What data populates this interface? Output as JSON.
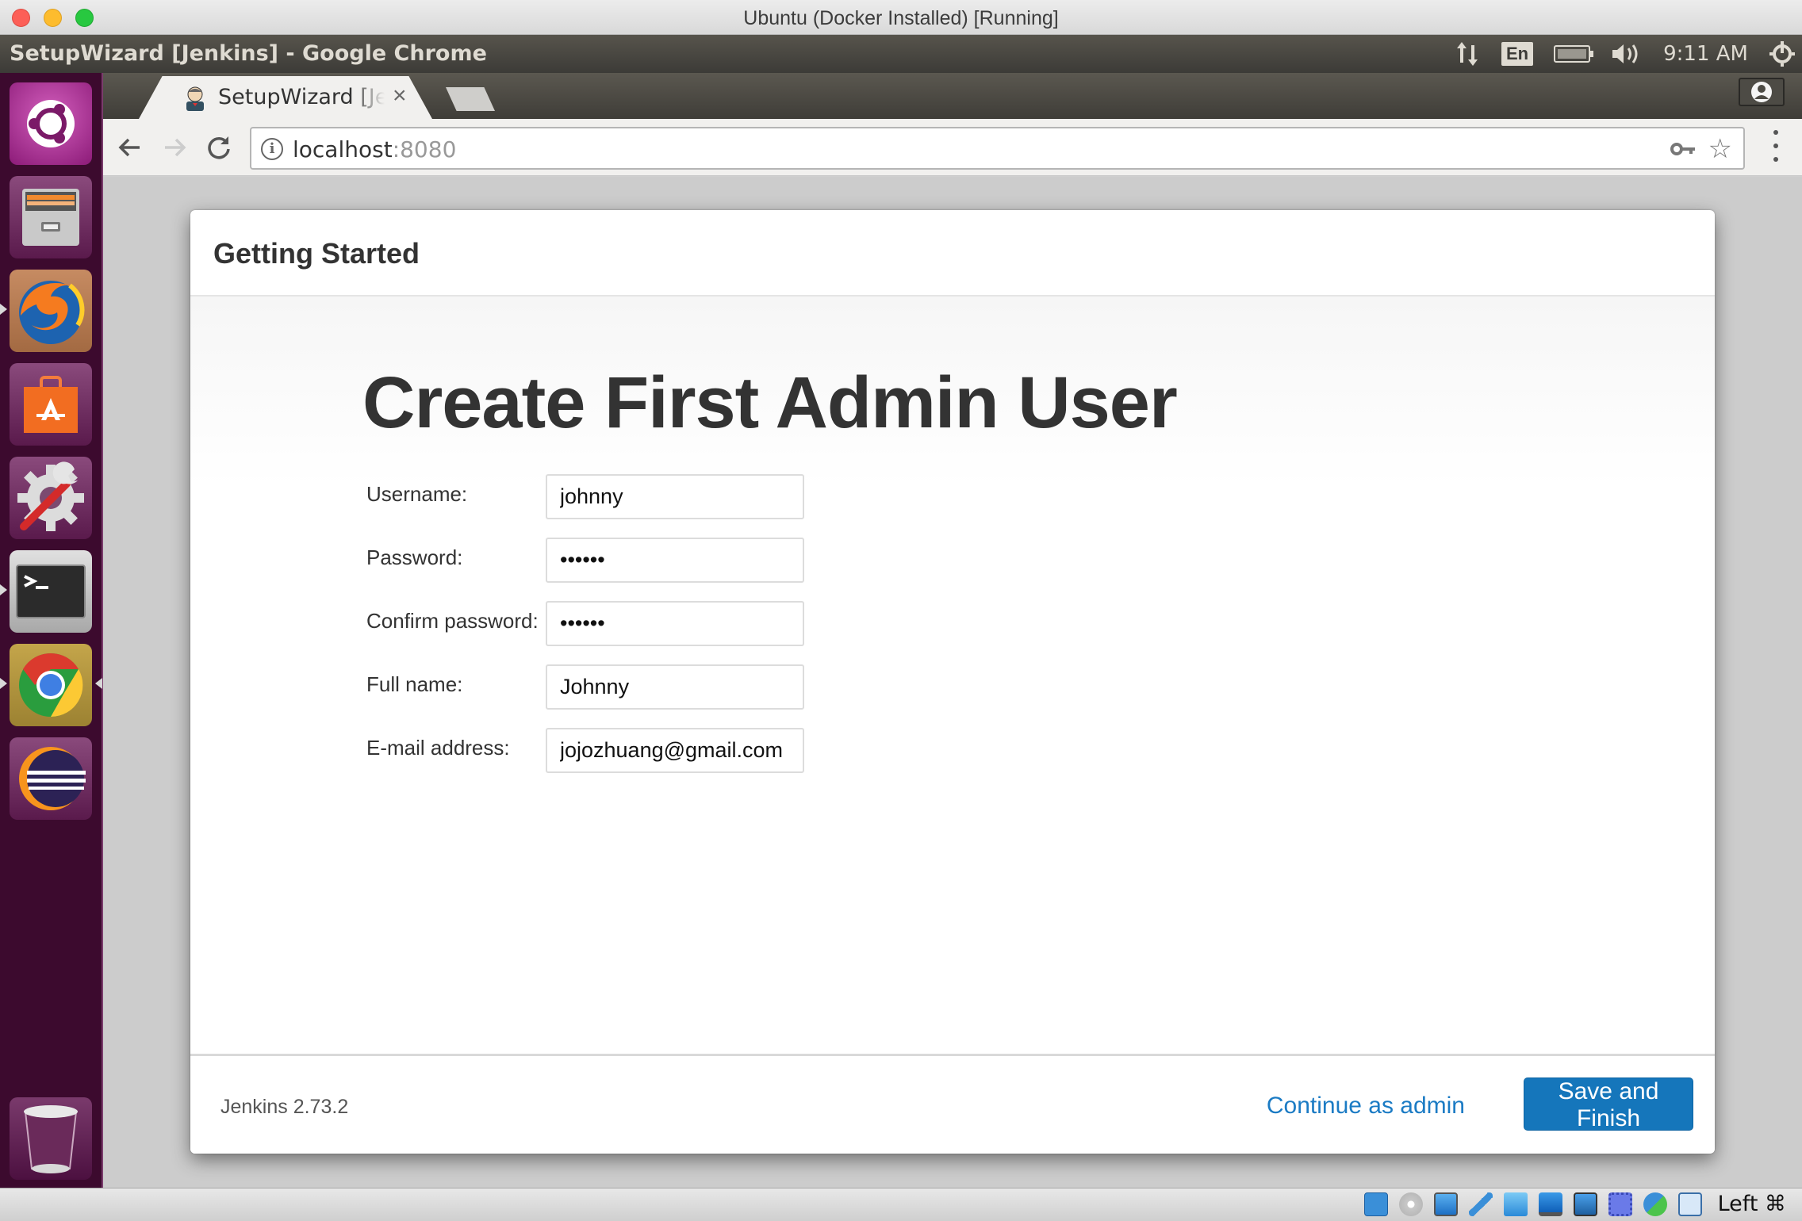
{
  "mac_window": {
    "title": "Ubuntu (Docker Installed) [Running]"
  },
  "ubuntu_panel": {
    "window_title": "SetupWizard [Jenkins] - Google Chrome",
    "indicators": {
      "network_icon": "network-updown-icon",
      "keyboard_layout": "En",
      "battery_icon": "battery-charging-icon",
      "volume_icon": "volume-icon",
      "clock": "9:11 AM",
      "power_icon": "power-gear-icon"
    }
  },
  "launcher": {
    "items": [
      {
        "name": "ubuntu-dash",
        "icon": "ubuntu-logo-icon"
      },
      {
        "name": "files",
        "icon": "file-cabinet-icon"
      },
      {
        "name": "firefox",
        "icon": "firefox-icon",
        "running": true
      },
      {
        "name": "software-center",
        "icon": "shopping-bag-icon"
      },
      {
        "name": "system-settings",
        "icon": "gear-wrench-icon"
      },
      {
        "name": "terminal",
        "icon": "terminal-icon",
        "running": true
      },
      {
        "name": "chrome",
        "icon": "chrome-icon",
        "running": true,
        "focused": true
      },
      {
        "name": "eclipse",
        "icon": "eclipse-icon"
      }
    ],
    "trash": {
      "name": "trash",
      "icon": "trash-icon"
    }
  },
  "browser": {
    "tab": {
      "title": "SetupWizard [Jenkins]",
      "close_glyph": "×"
    },
    "toolbar": {
      "back_glyph": "←",
      "forward_glyph": "→",
      "reload_glyph": "↻",
      "info_glyph": "i",
      "url_host": "localhost",
      "url_port": ":8080",
      "key_glyph": "⚷",
      "star_glyph": "☆"
    }
  },
  "wizard": {
    "header_title": "Getting Started",
    "heading": "Create First Admin User",
    "fields": [
      {
        "label": "Username:",
        "type": "text",
        "value": "johnny"
      },
      {
        "label": "Password:",
        "type": "password",
        "value": "••••••"
      },
      {
        "label": "Confirm password:",
        "type": "password",
        "value": "••••••"
      },
      {
        "label": "Full name:",
        "type": "text",
        "value": "Johnny"
      },
      {
        "label": "E-mail address:",
        "type": "text",
        "value": "jojozhuang@gmail.com"
      }
    ],
    "footer": {
      "version": "Jenkins 2.73.2",
      "continue_label": "Continue as admin",
      "save_label": "Save and Finish"
    }
  },
  "vbox_status": {
    "icons": [
      "hard-disk-icon",
      "optical-disk-icon",
      "network-icon",
      "usb-icon",
      "shared-folder-icon",
      "display-icon",
      "video-capture-icon",
      "cpu-icon",
      "mouse-integration-icon",
      "download-icon"
    ],
    "host_key": "Left ⌘"
  },
  "colors": {
    "primary_button": "#1576bb",
    "link": "#1b7bc4",
    "launcher_bg": "#3c0a2e",
    "panel_bg": "#3c3b37"
  }
}
